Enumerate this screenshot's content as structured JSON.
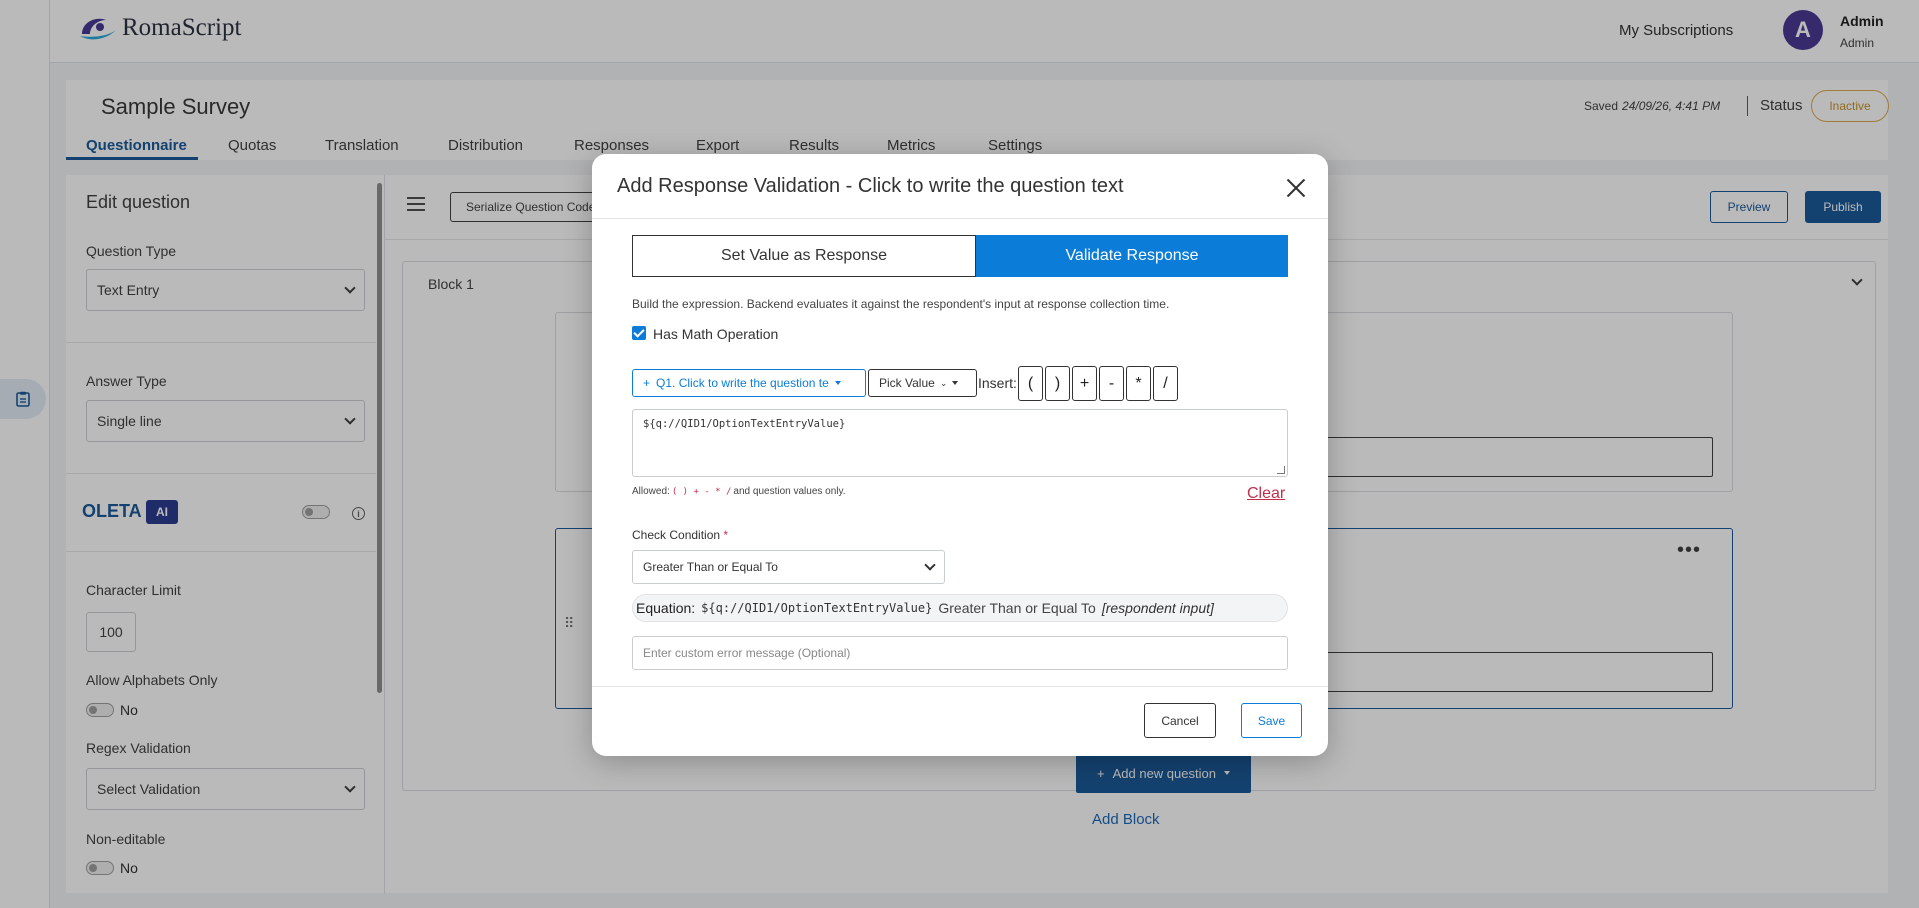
{
  "app": {
    "logo_text": "RomaScript"
  },
  "header": {
    "my_subscriptions": "My Subscriptions",
    "user": {
      "initial": "A",
      "name": "Admin",
      "role": "Admin"
    }
  },
  "survey": {
    "title": "Sample Survey",
    "saved_label": "Saved",
    "saved_time": "24/09/26, 4:41 PM",
    "status_label": "Status",
    "status_value": "Inactive"
  },
  "tabs": [
    "Questionnaire",
    "Quotas",
    "Translation",
    "Distribution",
    "Responses",
    "Export",
    "Results",
    "Metrics",
    "Settings"
  ],
  "left_panel": {
    "title": "Edit question",
    "question_type_label": "Question Type",
    "question_type_value": "Text Entry",
    "answer_type_label": "Answer Type",
    "answer_type_value": "Single line",
    "oleta_label": "OLETA",
    "ai_badge": "AI",
    "char_limit_label": "Character Limit",
    "char_limit_value": "100",
    "alpha_only_label": "Allow Alphabets Only",
    "alpha_only_value": "No",
    "regex_label": "Regex Validation",
    "regex_value": "Select Validation",
    "non_editable_label": "Non-editable",
    "non_editable_value": "No"
  },
  "main": {
    "serialize_label": "Serialize Question Codes",
    "preview_label": "Preview",
    "publish_label": "Publish",
    "block_title": "Block 1",
    "add_question_label": "Add new question",
    "add_block_label": "Add Block"
  },
  "modal": {
    "title": "Add Response Validation - Click to write the question text",
    "seg_left": "Set Value as Response",
    "seg_right": "Validate Response",
    "help_text": "Build the expression. Backend evaluates it against the respondent's input at response collection time.",
    "math_label": "Has Math Operation",
    "question_picker": "Q1. Click to write the question te",
    "pick_value": "Pick Value",
    "insert_label": "Insert:",
    "operators": [
      "(",
      ")",
      "+",
      "-",
      "*",
      "/"
    ],
    "expression": "${q://QID1/OptionTextEntryValue}",
    "allowed_prefix": "Allowed:",
    "allowed_ops": "( ) + - * /",
    "allowed_suffix": "and question values only.",
    "clear_label": "Clear",
    "check_condition_label": "Check Condition",
    "required_mark": "*",
    "check_condition_value": "Greater Than or Equal To",
    "equation_label": "Equation:",
    "equation_var": "${q://QID1/OptionTextEntryValue}",
    "equation_cond": "Greater Than or Equal To",
    "equation_input": "[respondent input]",
    "error_placeholder": "Enter custom error message (Optional)",
    "cancel_label": "Cancel",
    "save_label": "Save"
  },
  "colors": {
    "brand": "#0b4e92",
    "accent": "#0b7dd8",
    "danger": "#c0304b",
    "warning": "#d9a441"
  }
}
